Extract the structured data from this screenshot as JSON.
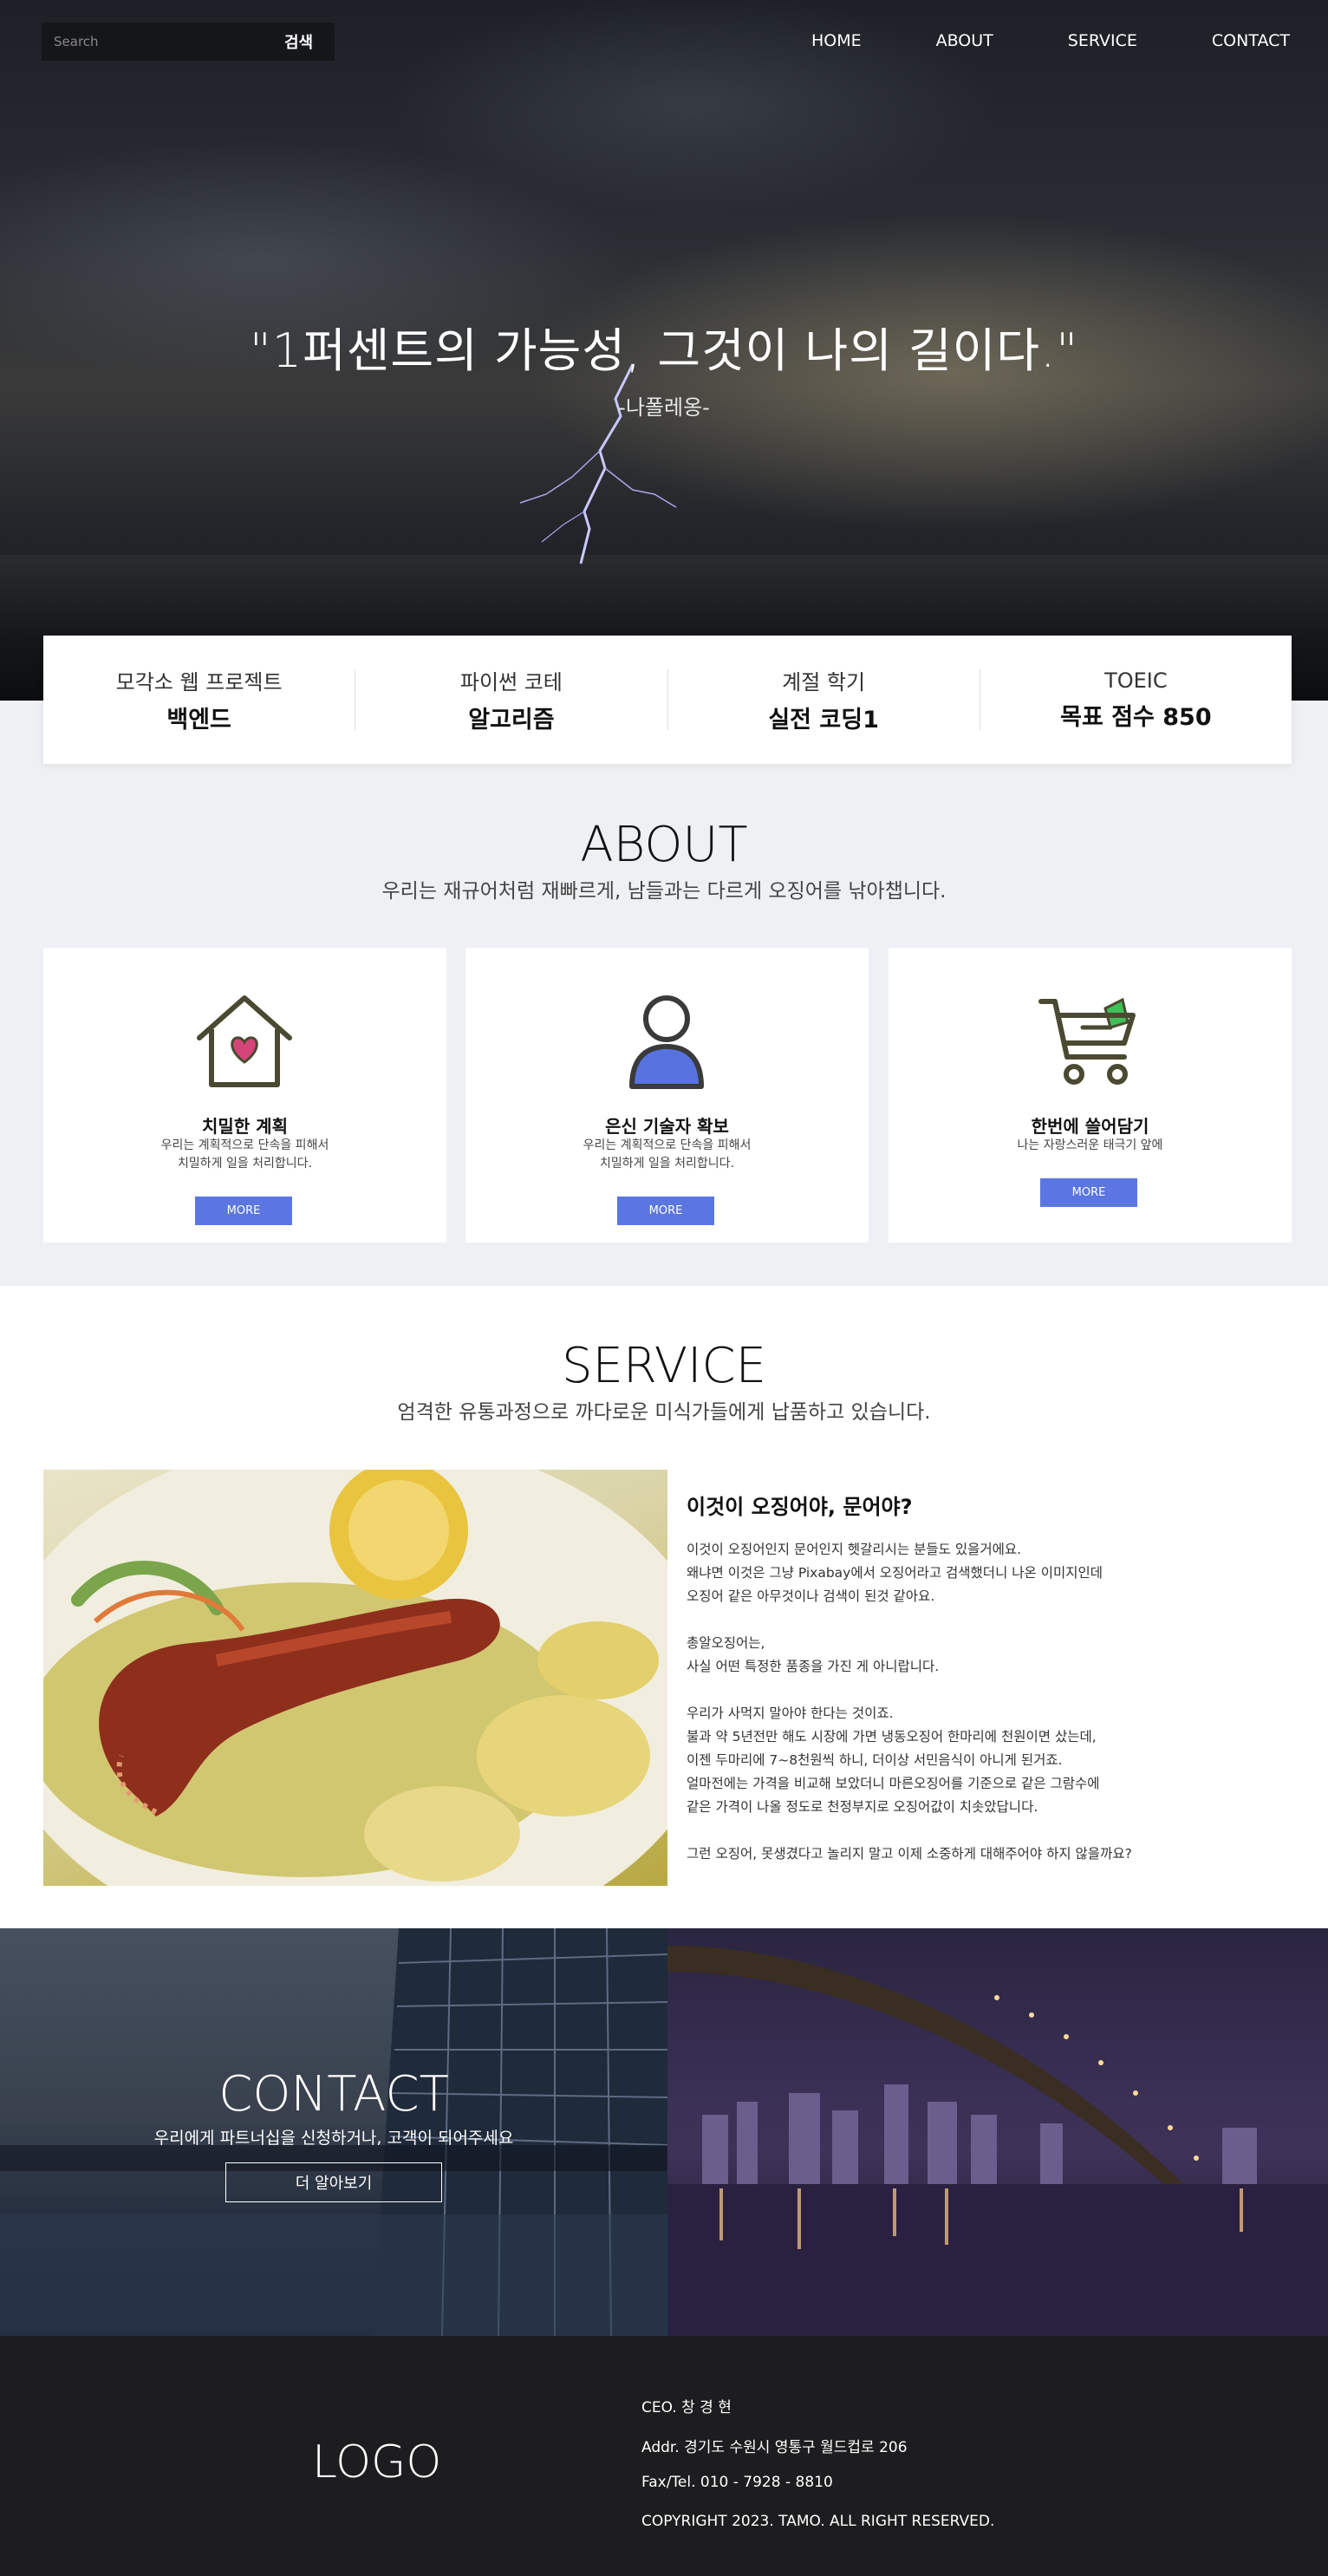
{
  "header": {
    "search_placeholder": "Search",
    "search_button": "검색",
    "nav": [
      "HOME",
      "ABOUT",
      "SERVICE",
      "CONTACT"
    ]
  },
  "hero": {
    "quote": "\"1퍼센트의 가능성, 그것이 나의 길이다.\"",
    "author": "-나폴레옹-"
  },
  "stats": [
    {
      "label": "모각소 웹 프로젝트",
      "value": "백엔드"
    },
    {
      "label": "파이썬 코테",
      "value": "알고리즘"
    },
    {
      "label": "계절 학기",
      "value": "실전 코딩1"
    },
    {
      "label": "TOEIC",
      "value": "목표 점수 850"
    }
  ],
  "about": {
    "title": "ABOUT",
    "subtitle": "우리는 재규어처럼 재빠르게, 남들과는 다르게 오징어를 낚아챕니다.",
    "cards": [
      {
        "icon": "house-heart-icon",
        "title": "치밀한 계획",
        "line1": "우리는 계획적으로 단속을 피해서",
        "line2": "치밀하게 일을 처리합니다.",
        "button": "MORE"
      },
      {
        "icon": "person-icon",
        "title": "은신 기술자 확보",
        "line1": "우리는 계획적으로 단속을 피해서",
        "line2": "치밀하게 일을 처리합니다.",
        "button": "MORE"
      },
      {
        "icon": "shopping-cart-icon",
        "title": "한번에 쓸어담기",
        "line1": "나는 자랑스러운 태극기 앞에",
        "line2": "",
        "button": "MORE"
      }
    ]
  },
  "service": {
    "title": "SERVICE",
    "subtitle": "엄격한 유통과정으로 까다로운 미식가들에게 납품하고 있습니다.",
    "heading": "이것이 오징어야, 문어야?",
    "paragraphs": [
      "이것이 오징어인지 문어인지 헷갈리시는 분들도 있을거에요.",
      "왜냐면 이것은 그냥 Pixabay에서 오징어라고 검색했더니 나온 이미지인데",
      "오징어 같은 아무것이나 검색이 된것 같아요.",
      "",
      "총알오징어는,",
      "사실 어떤 특정한 품종을 가진 게 아니랍니다.",
      "",
      "우리가 사먹지 말아야 한다는 것이죠.",
      "불과 약 5년전만 해도 시장에 가면 냉동오징어 한마리에 천원이면 샀는데,",
      "이젠 두마리에 7~8천원씩 하니, 더이상 서민음식이 아니게 된거죠.",
      "얼마전에는 가격을 비교해 보았더니 마른오징어를 기준으로 같은 그람수에",
      "같은 가격이 나올 정도로 천정부지로 오징어값이 치솟았답니다.",
      "",
      "그런 오징어, 못생겼다고 놀리지 말고 이제 소중하게 대해주어야 하지 않을까요?"
    ]
  },
  "contact": {
    "title": "CONTACT",
    "subtitle": "우리에게 파트너십을 신청하거나, 고객이 되어주세요",
    "button": "더 알아보기"
  },
  "footer": {
    "logo": "LOGO",
    "ceo": "CEO. 창 경 현",
    "addr": "Addr. 경기도 수원시 영통구 월드컵로 206",
    "tel": "Fax/Tel. 010 - 7928 - 8810",
    "copyright": "COPYRIGHT 2023. TAMO. ALL RIGHT RESERVED."
  }
}
